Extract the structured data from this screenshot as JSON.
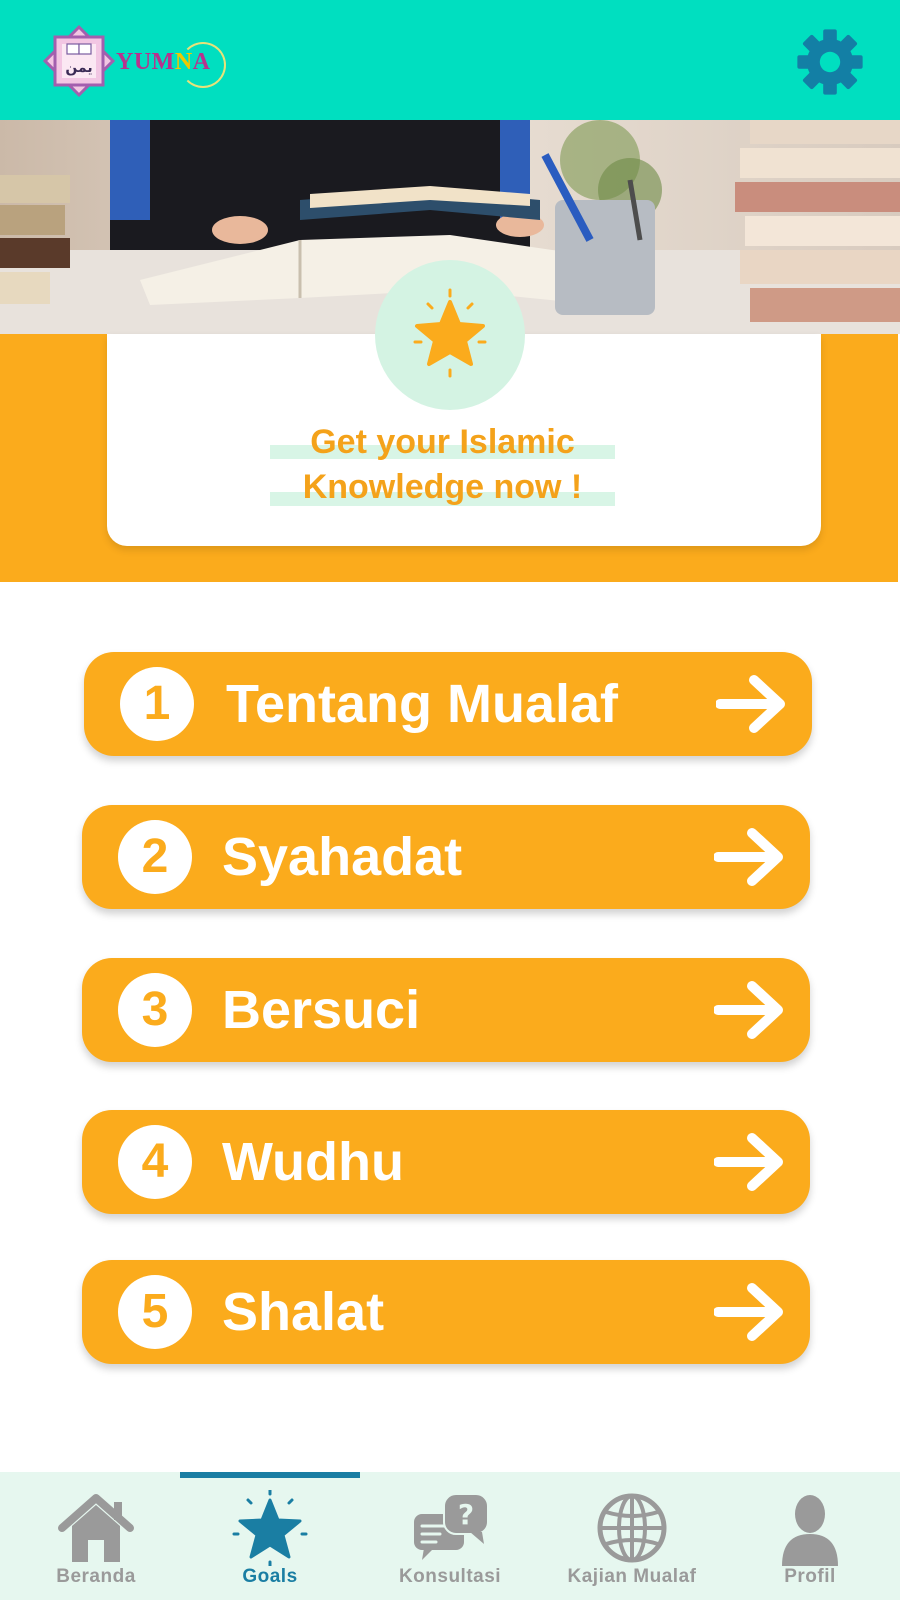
{
  "header": {
    "logo_text_part1": "YUM",
    "logo_text_part2": "N",
    "logo_text_part3": "A",
    "logo_arabic": "يمن",
    "settings_icon": "gear-icon"
  },
  "colors": {
    "header_bg": "#00dfc0",
    "accent_orange": "#fbab1c",
    "nav_active": "#1a7ea3",
    "nav_inactive": "#9a9a9a",
    "nav_bg": "#e6f7ef"
  },
  "hero": {
    "banner_icon": "star-icon",
    "headline_line1": "Get your Islamic",
    "headline_line2": "Knowledge now !"
  },
  "menu": [
    {
      "number": "1",
      "label": "Tentang Mualaf"
    },
    {
      "number": "2",
      "label": "Syahadat"
    },
    {
      "number": "3",
      "label": "Bersuci"
    },
    {
      "number": "4",
      "label": "Wudhu"
    },
    {
      "number": "5",
      "label": "Shalat"
    }
  ],
  "bottom_nav": [
    {
      "label": "Beranda",
      "icon": "home-icon",
      "active": false
    },
    {
      "label": "Goals",
      "icon": "star-icon",
      "active": true
    },
    {
      "label": "Konsultasi",
      "icon": "chat-question-icon",
      "active": false
    },
    {
      "label": "Kajian Mualaf",
      "icon": "globe-icon",
      "active": false
    },
    {
      "label": "Profil",
      "icon": "user-icon",
      "active": false
    }
  ]
}
